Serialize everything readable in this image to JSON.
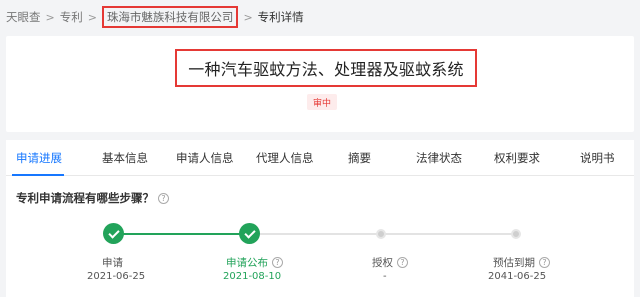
{
  "breadcrumb": {
    "home": "天眼查",
    "patent": "专利",
    "company": "珠海市魅族科技有限公司",
    "current": "专利详情",
    "separator": ">"
  },
  "patent": {
    "title": "一种汽车驱蚊方法、处理器及驱蚊系统",
    "status": "审中"
  },
  "tabs": [
    {
      "label": "申请进展",
      "active": true
    },
    {
      "label": "基本信息",
      "active": false
    },
    {
      "label": "申请人信息",
      "active": false
    },
    {
      "label": "代理人信息",
      "active": false
    },
    {
      "label": "摘要",
      "active": false
    },
    {
      "label": "法律状态",
      "active": false
    },
    {
      "label": "权利要求",
      "active": false
    },
    {
      "label": "说明书",
      "active": false
    }
  ],
  "progress": {
    "question": "专利申请流程有哪些步骤？",
    "help_icon": "question-circle-icon",
    "steps": [
      {
        "label": "申请",
        "date": "2021-06-25",
        "done": true,
        "has_help": false
      },
      {
        "label": "申请公布",
        "date": "2021-08-10",
        "done": true,
        "has_help": true
      },
      {
        "label": "授权",
        "date": "-",
        "done": false,
        "has_help": true
      },
      {
        "label": "预估到期",
        "date": "2041-06-25",
        "done": false,
        "has_help": true
      }
    ]
  },
  "colors": {
    "accent": "#1677ff",
    "done": "#22a35a",
    "highlight_box": "#e53935",
    "status": "#e53935"
  }
}
